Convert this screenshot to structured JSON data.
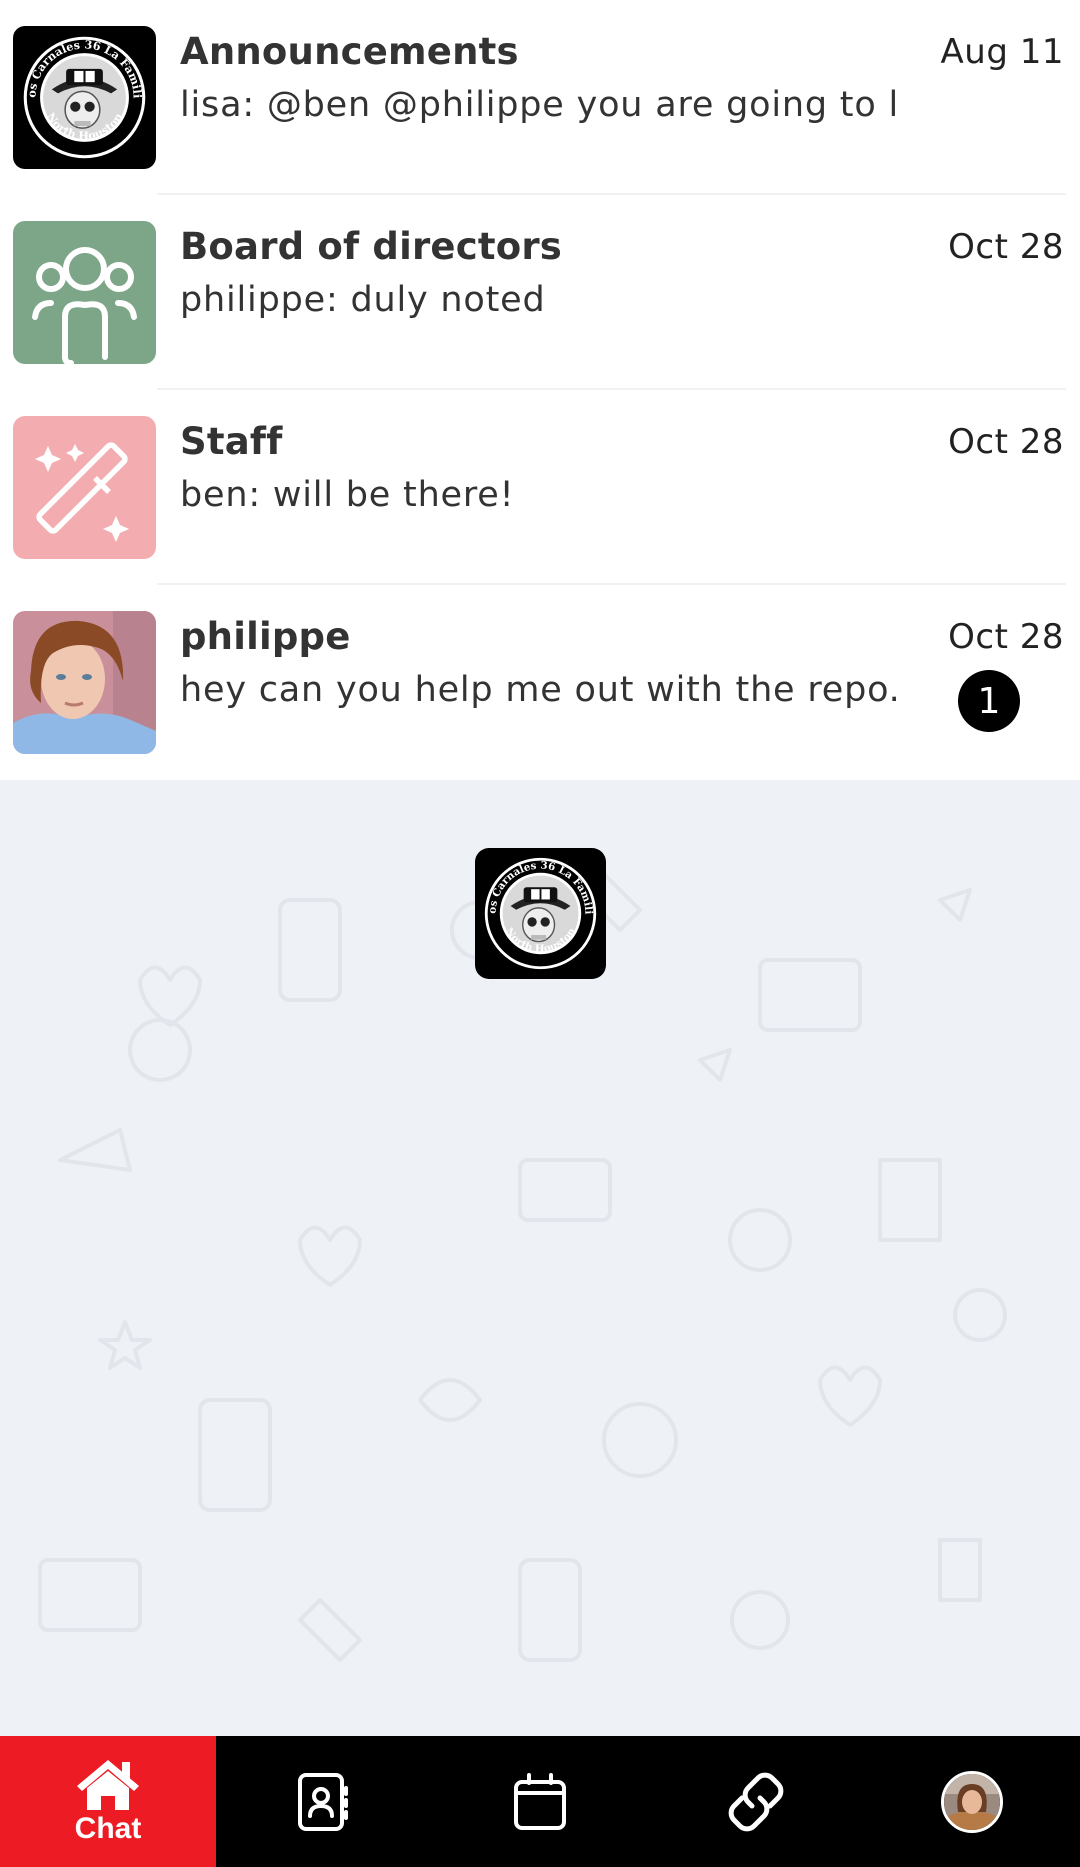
{
  "chats": [
    {
      "title": "Announcements",
      "preview": "lisa: @ben @philippe you are going to li...",
      "date": "Aug 11",
      "avatar": "club-logo",
      "unread": null
    },
    {
      "title": "Board of directors",
      "preview": "philippe: duly noted",
      "date": "Oct 28",
      "avatar": "group-icon",
      "avatar_color": "#7da587",
      "unread": null
    },
    {
      "title": "Staff",
      "preview": "ben: will be there!",
      "date": "Oct 28",
      "avatar": "magic-wand-icon",
      "avatar_color": "#f3adb0",
      "unread": null
    },
    {
      "title": "philippe",
      "preview": "hey can you help me out with the repo...",
      "date": "Oct 28",
      "avatar": "user-photo",
      "unread": "1"
    }
  ],
  "logo": {
    "top_text": "Los Carnales 36 La Familia",
    "bottom_text": "North Houston",
    "card_text": "36"
  },
  "nav": {
    "items": [
      {
        "label": "Chat",
        "icon": "home-icon",
        "active": true
      },
      {
        "label": "",
        "icon": "contacts-book-icon",
        "active": false
      },
      {
        "label": "",
        "icon": "calendar-icon",
        "active": false
      },
      {
        "label": "",
        "icon": "link-icon",
        "active": false
      },
      {
        "label": "",
        "icon": "profile-avatar",
        "active": false
      }
    ]
  },
  "colors": {
    "accent": "#ed1c24",
    "nav_background": "#000000",
    "page_background": "#eef1f5",
    "badge": "#000000"
  }
}
